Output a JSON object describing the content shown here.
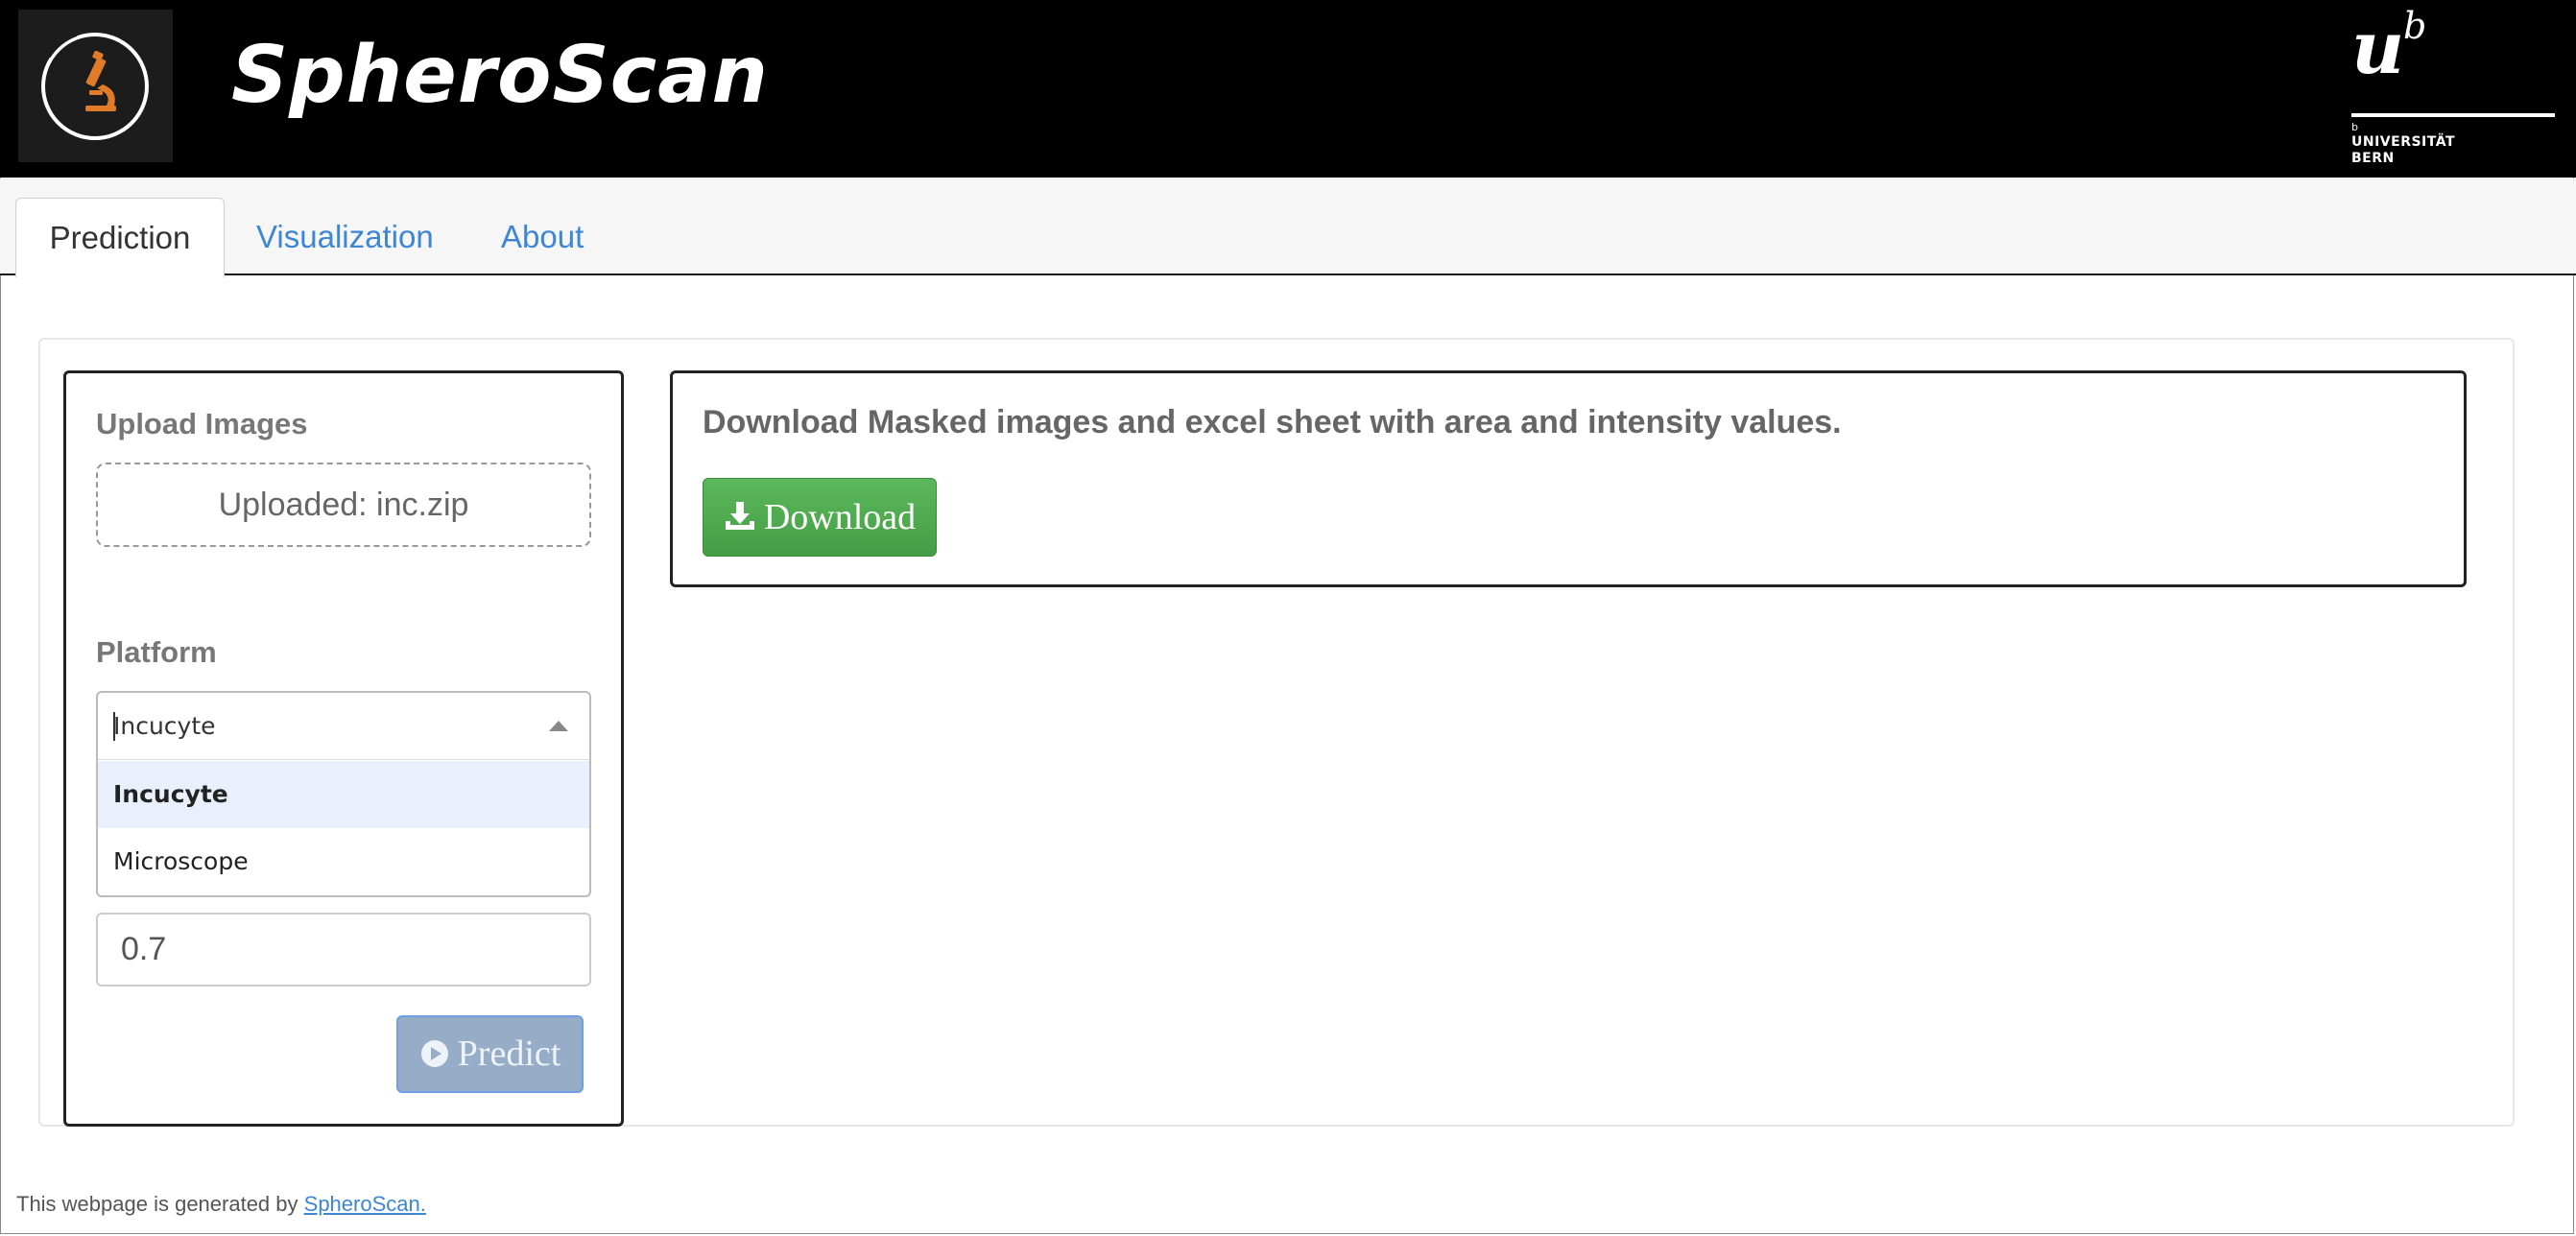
{
  "header": {
    "app_title": "SpheroScan",
    "university": {
      "logo_u": "u",
      "logo_b": "b",
      "small_b": "b",
      "line1": "UNIVERSITÄT",
      "line2": "BERN"
    },
    "logo_icon": "microscope-icon",
    "logo_color": "#e07b2a"
  },
  "tabs": [
    {
      "label": "Prediction",
      "active": true
    },
    {
      "label": "Visualization",
      "active": false
    },
    {
      "label": "About",
      "active": false
    }
  ],
  "sidebar": {
    "upload_label": "Upload Images",
    "upload_status": "Uploaded: inc.zip",
    "platform_label": "Platform",
    "platform_selected": "Incucyte",
    "platform_options": [
      "Incucyte",
      "Microscope"
    ],
    "threshold_value": "0.7",
    "predict_label": "Predict",
    "predict_icon": "play-circle-icon"
  },
  "main": {
    "title": "Download Masked images and excel sheet with area and intensity values.",
    "download_label": "Download",
    "download_icon": "download-icon"
  },
  "footer": {
    "text": "This webpage is generated by ",
    "link": "SpheroScan."
  },
  "colors": {
    "header_bg": "#000000",
    "link": "#3d86d4",
    "download_green": "#5cb85c",
    "predict_disabled": "#97acc6"
  }
}
